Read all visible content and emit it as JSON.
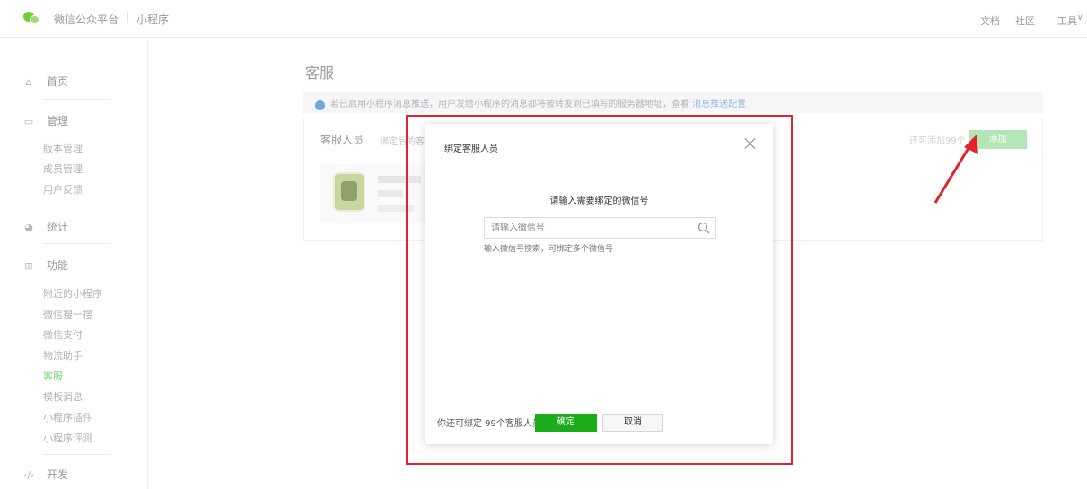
{
  "header": {
    "brand": "微信公众平台",
    "separator": "|",
    "product": "小程序",
    "links": [
      "文档",
      "社区",
      "工具"
    ],
    "tools_caret": "∨"
  },
  "sidebar": {
    "home": "首页",
    "manage": {
      "label": "管理",
      "items": [
        "版本管理",
        "成员管理",
        "用户反馈"
      ]
    },
    "stats": "统计",
    "features": {
      "label": "功能",
      "items": [
        "附近的小程序",
        "微信搜一搜",
        "微信支付",
        "物流助手",
        "客服",
        "模板消息",
        "小程序插件",
        "小程序评测"
      ],
      "active": "客服"
    },
    "dev": "开发"
  },
  "main": {
    "title": "客服",
    "notice": "若已启用小程序消息推送，用户发给小程序的消息都将被转发到已填写的服务器地址，查看",
    "notice_link": "消息推送配置",
    "section_title": "客服人员",
    "section_sub": "绑定后的客",
    "remain": "还可添加99个",
    "add_button": "添加"
  },
  "dialog": {
    "title": "绑定客服人员",
    "prompt": "请输入需要绑定的微信号",
    "search_placeholder": "请输入微信号",
    "hint": "输入微信号搜索，可绑定多个微信号",
    "footer": "你还可绑定 99个客服人员",
    "ok": "确定",
    "cancel": "取消"
  },
  "colors": {
    "primary_green": "#1aad19",
    "annotation_red": "#e3222e",
    "add_button_bg": "#b4e6b5"
  }
}
